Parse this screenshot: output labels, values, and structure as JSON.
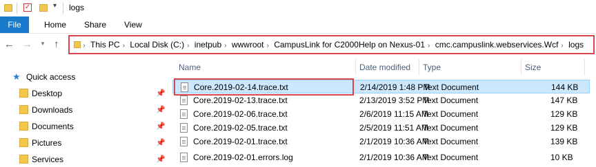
{
  "window": {
    "title": "logs"
  },
  "ribbon": {
    "tabs": [
      "File",
      "Home",
      "Share",
      "View"
    ]
  },
  "nav": {
    "back": "←",
    "forward": "→",
    "up": "↑"
  },
  "address": {
    "crumbs": [
      "This PC",
      "Local Disk (C:)",
      "inetpub",
      "wwwroot",
      "CampusLink for C2000Help on Nexus-01",
      "cmc.campuslink.webservices.Wcf",
      "logs"
    ]
  },
  "sidebar": {
    "items": [
      {
        "label": "Quick access",
        "icon": "star-icon"
      },
      {
        "label": "Desktop",
        "icon": "folder-icon",
        "pinned": true
      },
      {
        "label": "Downloads",
        "icon": "folder-icon",
        "pinned": true
      },
      {
        "label": "Documents",
        "icon": "folder-icon",
        "pinned": true
      },
      {
        "label": "Pictures",
        "icon": "folder-icon",
        "pinned": true
      },
      {
        "label": "Services",
        "icon": "folder-icon",
        "pinned": true
      }
    ]
  },
  "columns": {
    "name": "Name",
    "date": "Date modified",
    "type": "Type",
    "size": "Size"
  },
  "files": [
    {
      "name": "Core.2019-02-14.trace.txt",
      "date": "2/14/2019 1:48 PM",
      "type": "Text Document",
      "size": "144 KB"
    },
    {
      "name": "Core.2019-02-13.trace.txt",
      "date": "2/13/2019 3:52 PM",
      "type": "Text Document",
      "size": "147 KB"
    },
    {
      "name": "Core.2019-02-06.trace.txt",
      "date": "2/6/2019 11:15 AM",
      "type": "Text Document",
      "size": "129 KB"
    },
    {
      "name": "Core.2019-02-05.trace.txt",
      "date": "2/5/2019 11:51 AM",
      "type": "Text Document",
      "size": "129 KB"
    },
    {
      "name": "Core.2019-02-01.trace.txt",
      "date": "2/1/2019 10:36 AM",
      "type": "Text Document",
      "size": "139 KB"
    },
    {
      "name": "Core.2019-02-01.errors.log",
      "date": "2/1/2019 10:36 AM",
      "type": "Text Document",
      "size": "10 KB"
    }
  ]
}
